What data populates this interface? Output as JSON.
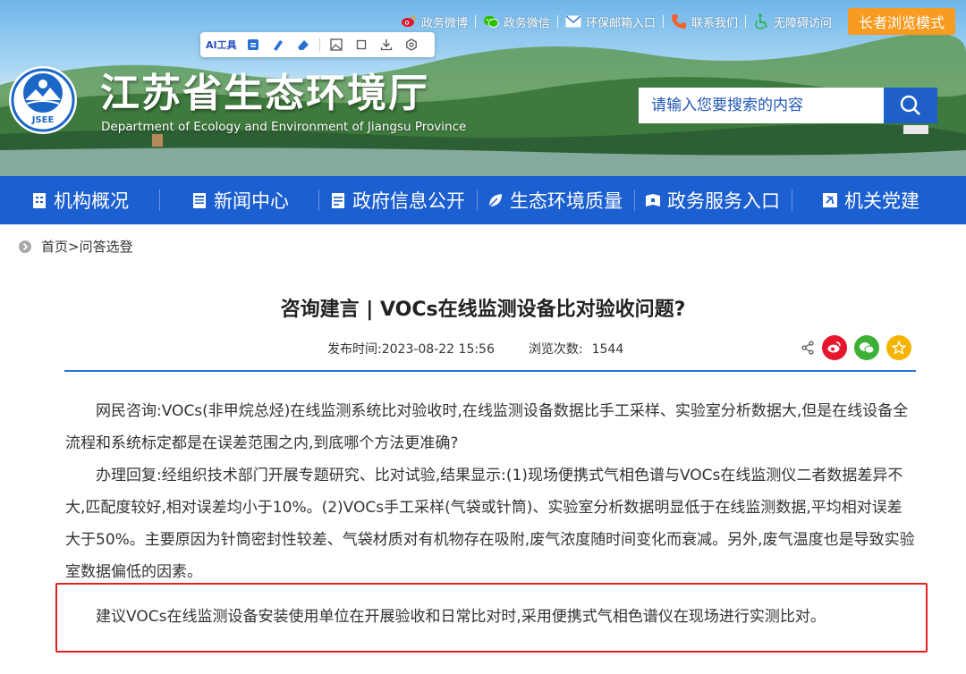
{
  "top_links": [
    {
      "label": "政务微博",
      "icon": "weibo-icon"
    },
    {
      "label": "政务微信",
      "icon": "wechat-icon"
    },
    {
      "label": "环保邮箱入口",
      "icon": "mail-icon"
    },
    {
      "label": "联系我们",
      "icon": "phone-icon"
    },
    {
      "label": "无障碍访问",
      "icon": "accessibility-icon"
    }
  ],
  "elder_mode_label": "长者浏览模式",
  "toolbar": {
    "ai_label": "AI工具"
  },
  "site": {
    "title": "江苏省生态环境厅",
    "subtitle": "Department of Ecology and Environment of Jiangsu Province",
    "logo_text": "JSEE"
  },
  "search": {
    "placeholder": "请输入您要搜索的内容"
  },
  "nav": [
    {
      "label": "机构概况",
      "icon": "building-icon"
    },
    {
      "label": "新闻中心",
      "icon": "news-icon"
    },
    {
      "label": "政府信息公开",
      "icon": "document-icon"
    },
    {
      "label": "生态环境质量",
      "icon": "leaf-icon"
    },
    {
      "label": "政务服务入口",
      "icon": "service-icon"
    },
    {
      "label": "机关党建",
      "icon": "party-icon"
    }
  ],
  "breadcrumb": {
    "home": "首页",
    "separator": ">",
    "current": "问答选登"
  },
  "article": {
    "title": "咨询建言 | VOCs在线监测设备比对验收问题?",
    "publish_label": "发布时间:",
    "publish_time": "2023-08-22 15:56",
    "views_label": "浏览次数:",
    "views": "1544",
    "paragraphs": [
      "网民咨询:VOCs(非甲烷总烃)在线监测系统比对验收时,在线监测设备数据比手工采样、实验室分析数据大,但是在线设备全流程和系统标定都是在误差范围之内,到底哪个方法更准确?",
      "办理回复:经组织技术部门开展专题研究、比对试验,结果显示:(1)现场便携式气相色谱与VOCs在线监测仪二者数据差异不大,匹配度较好,相对误差均小于10%。(2)VOCs手工采样(气袋或针筒)、实验室分析数据明显低于在线监测数据,平均相对误差大于50%。主要原因为针筒密封性较差、气袋材质对有机物存在吸附,废气浓度随时间变化而衰减。另外,废气温度也是导致实验室数据偏低的因素。",
      "建议VOCs在线监测设备安装使用单位在开展验收和日常比对时,采用便携式气相色谱仪在现场进行实测比对。"
    ]
  },
  "colors": {
    "nav_bg": "#1b5fd0",
    "elder_btn": "#f79b21",
    "highlight_border": "#e31f1f",
    "rule": "#2a73d9"
  }
}
